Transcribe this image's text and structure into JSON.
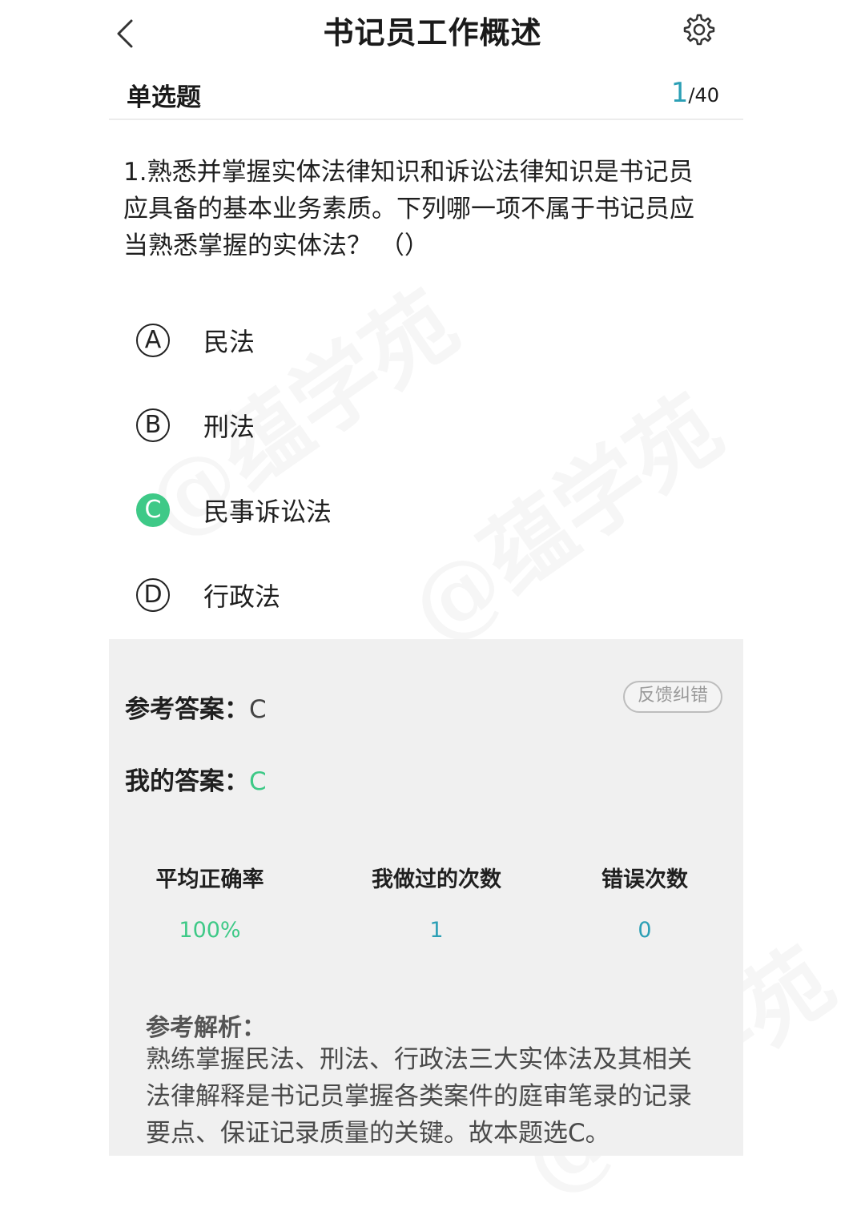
{
  "header": {
    "title": "书记员工作概述",
    "back_icon": "chevron-left-icon",
    "settings_icon": "gear-icon"
  },
  "subheader": {
    "question_type": "单选题",
    "current": "1",
    "total": "/40"
  },
  "question": {
    "text": "1.熟悉并掌握实体法律知识和诉讼法律知识是书记员应具备的基本业务素质。下列哪一项不属于书记员应当熟悉掌握的实体法？ （）"
  },
  "options": [
    {
      "letter": "A",
      "label": "民法",
      "selected": false
    },
    {
      "letter": "B",
      "label": "刑法",
      "selected": false
    },
    {
      "letter": "C",
      "label": "民事诉讼法",
      "selected": true
    },
    {
      "letter": "D",
      "label": "行政法",
      "selected": false
    }
  ],
  "answer": {
    "reference_label": "参考答案：",
    "reference_value": "C",
    "mine_label": "我的答案：",
    "mine_value": "C",
    "feedback_label": "反馈纠错"
  },
  "stats": [
    {
      "label": "平均正确率",
      "value": "100%"
    },
    {
      "label": "我做过的次数",
      "value": "1"
    },
    {
      "label": "错误次数",
      "value": "0"
    }
  ],
  "explanation": {
    "heading": "参考解析：",
    "text": "熟练掌握民法、刑法、行政法三大实体法及其相关法律解释是书记员掌握各类案件的庭审笔录的记录要点、保证记录质量的关键。故本题选C。"
  },
  "colors": {
    "accent_green": "#3ec987",
    "accent_teal": "#2b9fb5",
    "panel_bg": "#f0f0f0"
  }
}
